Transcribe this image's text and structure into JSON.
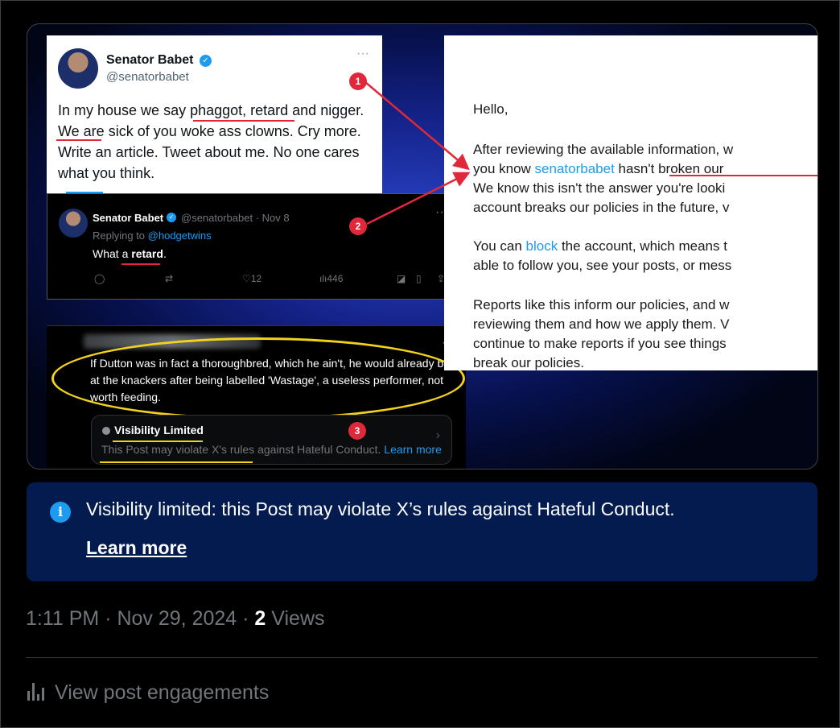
{
  "media": {
    "tweet1": {
      "name": "Senator Babet",
      "handle": "@senatorbabet",
      "text": "In my house we say phaggot, retard and nigger. We are sick of you woke ass clowns. Cry more. Write an article. Tweet about me. No one cares what you think."
    },
    "tweet2": {
      "name": "Senator Babet",
      "meta": "@senatorbabet · Nov 8",
      "replying_to_label": "Replying to",
      "replying_to": "@hodgetwins",
      "text_prefix": "What a ",
      "text_word": "retard",
      "text_suffix": ".",
      "likes": "12",
      "views": "446"
    },
    "tweet3": {
      "text": "If Dutton was in fact a thoroughbred, which he ain't, he would already be at the knackers after being labelled 'Wastage', a useless performer, not worth feeding.",
      "notice_title": "Visibility Limited",
      "notice_text": "This Post may violate X's rules against Hateful Conduct.",
      "notice_link": "Learn more"
    },
    "email": {
      "greeting": "Hello,",
      "p1_a": "After reviewing the available information, w",
      "p1_b": "you know ",
      "p1_link": "senatorbabet",
      "p1_c": " hasn't broken our",
      "p1_d": "We know this isn't the answer you're looki",
      "p1_e": "account breaks our policies in the future, v",
      "p2_a": "You can ",
      "p2_link": "block",
      "p2_b": " the account, which means t",
      "p2_c": "able to follow you, see your posts, or mess",
      "p3": "Reports like this inform our policies, and w\nreviewing them and how we apply them. V\ncontinue to make reports if you see things\nbreak our policies."
    },
    "markers": [
      "1",
      "2",
      "3"
    ]
  },
  "visibility": {
    "message": "Visibility limited: this Post may violate X’s rules against Hateful Conduct.",
    "link": "Learn more"
  },
  "post_meta": {
    "time": "1:11 PM · Nov 29, 2024 · ",
    "views_count": "2",
    "views_label": " Views"
  },
  "engagements": "View post engagements"
}
